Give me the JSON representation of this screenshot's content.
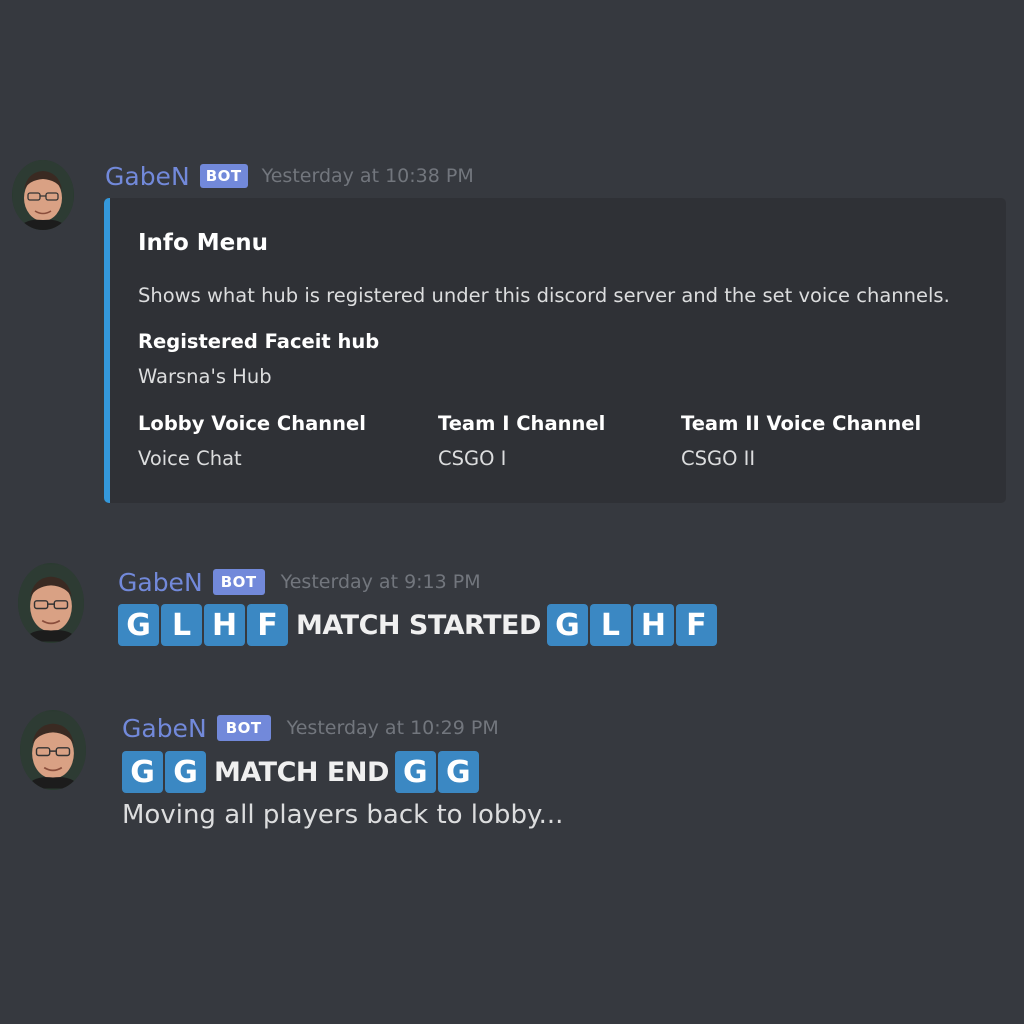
{
  "messages": [
    {
      "author": "GabeN",
      "badge": "BOT",
      "timestamp": "Yesterday at 10:38 PM",
      "avatar_icon": "gabe-newell-avatar",
      "embed": {
        "accent_color": "#3498db",
        "title": "Info Menu",
        "description": "Shows what hub is registered under this discord server and the set voice channels.",
        "fields": [
          {
            "name": "Registered Faceit hub",
            "value": "Warsna's Hub"
          },
          {
            "name": "Lobby Voice Channel",
            "value": "Voice Chat"
          },
          {
            "name": "Team I Channel",
            "value": "CSGO I"
          },
          {
            "name": "Team II Voice Channel",
            "value": "CSGO II"
          }
        ]
      }
    },
    {
      "author": "GabeN",
      "badge": "BOT",
      "timestamp": "Yesterday at 9:13 PM",
      "avatar_icon": "gabe-newell-avatar",
      "lead_emoji": [
        "G",
        "L",
        "H",
        "F"
      ],
      "text": "MATCH STARTED",
      "trail_emoji": [
        "G",
        "L",
        "H",
        "F"
      ]
    },
    {
      "author": "GabeN",
      "badge": "BOT",
      "timestamp": "Yesterday at 10:29 PM",
      "avatar_icon": "gabe-newell-avatar",
      "lead_emoji": [
        "G",
        "G"
      ],
      "text": "MATCH END",
      "trail_emoji": [
        "G",
        "G"
      ],
      "subtext": "Moving all players back to lobby..."
    }
  ],
  "colors": {
    "background": "#36393f",
    "embed_background": "#2f3136",
    "username": "#7289da",
    "bot_badge": "#7289da",
    "timestamp": "#72767d",
    "regional_indicator": "#3b88c3"
  }
}
